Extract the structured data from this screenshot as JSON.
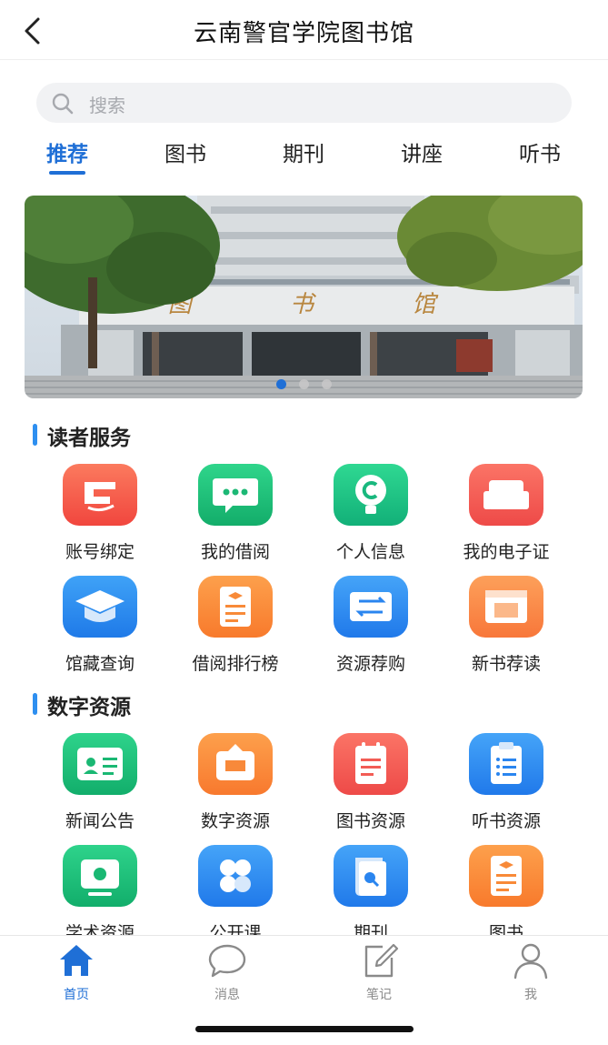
{
  "header": {
    "title": "云南警官学院图书馆",
    "back_icon": "chevron-left-icon"
  },
  "search": {
    "placeholder": "搜索",
    "icon": "search-icon"
  },
  "tabs": [
    {
      "label": "推荐",
      "active": true
    },
    {
      "label": "图书",
      "active": false
    },
    {
      "label": "期刊",
      "active": false
    },
    {
      "label": "讲座",
      "active": false
    },
    {
      "label": "听书",
      "active": false
    }
  ],
  "banner": {
    "sign_text": "图 书 馆",
    "slide_count": 3,
    "active_slide": 1
  },
  "reader_services": {
    "title": "读者服务",
    "items": [
      {
        "label": "账号绑定",
        "icon": "id-card-icon",
        "color": "#f45d4f"
      },
      {
        "label": "我的借阅",
        "icon": "message-dots-icon",
        "color": "#20c07a"
      },
      {
        "label": "个人信息",
        "icon": "person-bulb-icon",
        "color": "#1fc38a"
      },
      {
        "label": "我的电子证",
        "icon": "sofa-icon",
        "color": "#f35b58"
      },
      {
        "label": "馆藏查询",
        "icon": "graduation-cap-icon",
        "color": "#2b8ef1"
      },
      {
        "label": "借阅排行榜",
        "icon": "report-icon",
        "color": "#fb8c3c"
      },
      {
        "label": "资源荐购",
        "icon": "exchange-icon",
        "color": "#2f8df4"
      },
      {
        "label": "新书荐读",
        "icon": "book-window-icon",
        "color": "#fb8a46"
      }
    ]
  },
  "digital_resources": {
    "title": "数字资源",
    "items": [
      {
        "label": "新闻公告",
        "icon": "contact-card-icon",
        "color": "#1fc07c"
      },
      {
        "label": "数字资源",
        "icon": "frame-icon",
        "color": "#fb8a3a"
      },
      {
        "label": "图书资源",
        "icon": "notepad-icon",
        "color": "#f4605a"
      },
      {
        "label": "听书资源",
        "icon": "clipboard-list-icon",
        "color": "#2f8af5"
      },
      {
        "label": "学术资源",
        "icon": "screen-icon",
        "color": "#20c07d"
      },
      {
        "label": "公开课",
        "icon": "clover-icon",
        "color": "#2f8af5"
      },
      {
        "label": "期刊",
        "icon": "magazine-icon",
        "color": "#2f8af5"
      },
      {
        "label": "图书",
        "icon": "certificate-icon",
        "color": "#fb8c3c"
      }
    ]
  },
  "tabbar": [
    {
      "label": "首页",
      "icon": "home-icon",
      "active": true
    },
    {
      "label": "消息",
      "icon": "chat-bubble-icon",
      "active": false
    },
    {
      "label": "笔记",
      "icon": "edit-note-icon",
      "active": false
    },
    {
      "label": "我",
      "icon": "user-icon",
      "active": false
    }
  ],
  "colors": {
    "accent": "#1f6fd6",
    "section_bar": "#2e8ff0"
  }
}
